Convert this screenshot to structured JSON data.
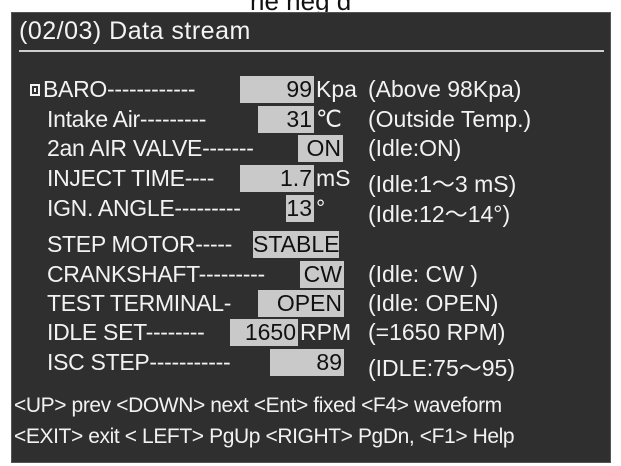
{
  "top_fragment": "ne        neg           d",
  "header": {
    "title": "(02/03)  Data stream"
  },
  "rows": [
    {
      "label": "BARO------------",
      "value": "99",
      "unit": "Kpa",
      "hint": "(Above 98Kpa)"
    },
    {
      "label": "Intake Air---------",
      "value": "31",
      "unit": "℃",
      "hint": "(Outside Temp.)"
    },
    {
      "label": "2an AIR VALVE-------",
      "value": "ON",
      "unit": "",
      "hint": "(Idle:ON)"
    },
    {
      "label": "INJECT TIME----",
      "value": "1.7",
      "unit": "mS",
      "hint": "(Idle:1～3 mS)"
    },
    {
      "label": "IGN. ANGLE---------",
      "value": "13",
      "unit": "°",
      "hint": "(Idle:12～14°)"
    },
    {
      "label": "STEP MOTOR-----",
      "value": "STABLE",
      "unit": "",
      "hint": ""
    },
    {
      "label": "CRANKSHAFT---------",
      "value": "CW",
      "unit": "",
      "hint": "(Idle: CW )"
    },
    {
      "label": "TEST TERMINAL-",
      "value": "OPEN",
      "unit": "",
      "hint": "(Idle: OPEN)"
    },
    {
      "label": "IDLE SET--------",
      "value": "1650",
      "unit": "RPM",
      "hint": "(=1650 RPM)"
    },
    {
      "label": "ISC STEP-----------",
      "value": "89",
      "unit": "",
      "hint": "(IDLE:75～95)"
    }
  ],
  "footer": {
    "line1": "<UP> prev  <DOWN> next  <Ent> fixed  <F4> waveform",
    "line2": "<EXIT> exit  <  LEFT> PgUp <RIGHT> PgDn,  <F1> Help"
  }
}
